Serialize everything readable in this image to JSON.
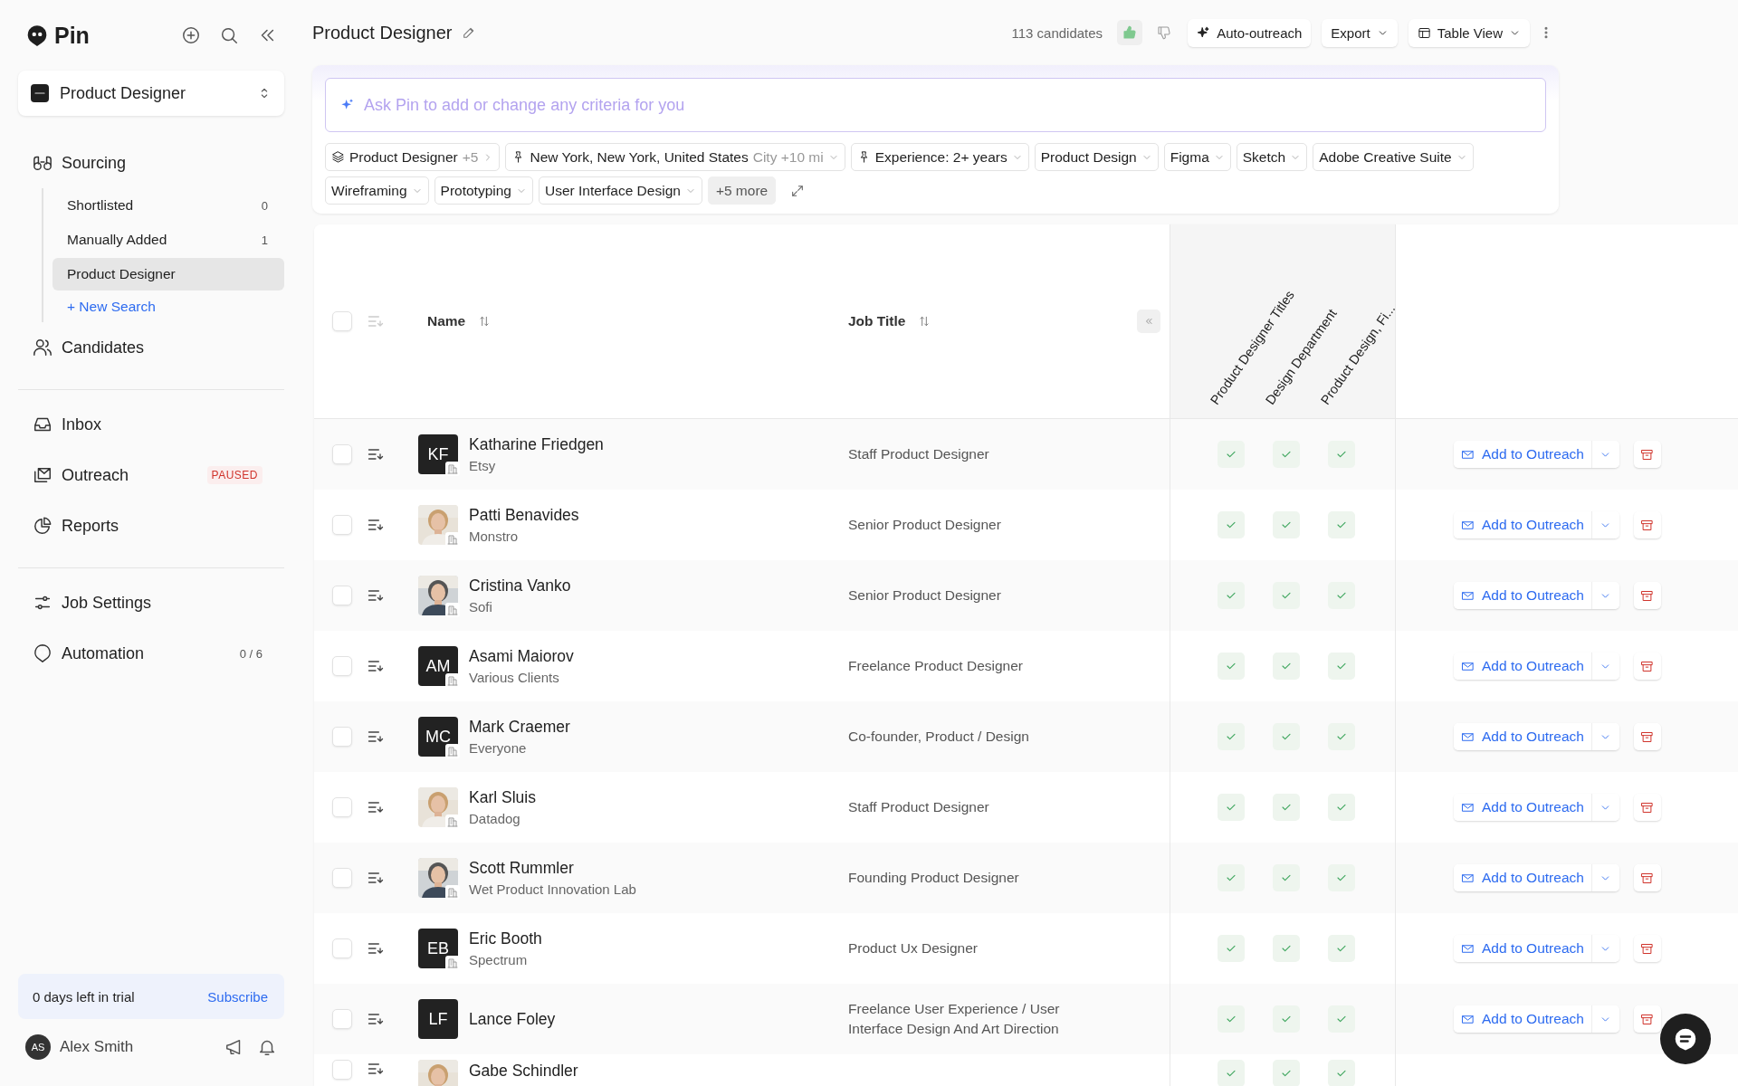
{
  "sidebar": {
    "logo": "Pin",
    "workspace": "Product Designer",
    "groups": [
      {
        "items": [
          {
            "label": "Sourcing",
            "children": [
              {
                "label": "Shortlisted",
                "count": "0",
                "selected": false
              },
              {
                "label": "Manually Added",
                "count": "1",
                "selected": false
              },
              {
                "label": "Product Designer",
                "selected": true
              }
            ],
            "new_search": "+ New Search"
          },
          {
            "label": "Candidates"
          }
        ]
      },
      {
        "items": [
          {
            "label": "Inbox"
          },
          {
            "label": "Outreach",
            "badge": "PAUSED"
          },
          {
            "label": "Reports"
          }
        ]
      },
      {
        "items": [
          {
            "label": "Job Settings"
          },
          {
            "label": "Automation",
            "count": "0 / 6"
          }
        ]
      }
    ],
    "trial": {
      "text": "0 days left in trial",
      "link": "Subscribe"
    },
    "user": {
      "initials": "AS",
      "name": "Alex Smith"
    }
  },
  "header": {
    "title": "Product Designer",
    "count": "113 candidates",
    "buttons": [
      {
        "label": "Auto-outreach",
        "kind": "sparkle"
      },
      {
        "label": "Export",
        "kind": "menu"
      },
      {
        "label": "Table View",
        "kind": "view"
      }
    ]
  },
  "criteria": {
    "placeholder": "Ask Pin to add or change any criteria for you",
    "chips": [
      {
        "kind": "title",
        "label": "Product Designer",
        "suffix": "+5"
      },
      {
        "kind": "location",
        "label": "New York, New York, United States",
        "suffix": "City +10 mi"
      },
      {
        "kind": "pinned",
        "label": "Experience: 2+ years"
      },
      {
        "kind": "plain",
        "label": "Product Design"
      },
      {
        "kind": "plain",
        "label": "Figma"
      },
      {
        "kind": "plain",
        "label": "Sketch"
      },
      {
        "kind": "plain",
        "label": "Adobe Creative Suite"
      },
      {
        "kind": "plain",
        "label": "Wireframing"
      },
      {
        "kind": "plain",
        "label": "Prototyping"
      },
      {
        "kind": "plain",
        "label": "User Interface Design"
      },
      {
        "kind": "more",
        "label": "+5 more"
      }
    ]
  },
  "table": {
    "select_all": {
      "checked": false
    },
    "columns": [
      "Name",
      "Job Title"
    ],
    "criteria_columns": [
      "Product Designer Titles",
      "Design Department",
      "Product Design, Fi..."
    ],
    "rows": [
      {
        "checked": false,
        "avatar": {
          "kind": "initials",
          "text": "KF"
        },
        "name": "Katharine Friedgen",
        "company": "Etsy",
        "title": "Staff Product Designer",
        "checks": [
          {
            "met": true
          },
          {
            "met": true
          },
          {
            "met": true
          }
        ],
        "action": "Add to Outreach"
      },
      {
        "checked": false,
        "name": "Patti Benavides",
        "company": "Monstro",
        "title": "Senior Product Designer",
        "checks": [
          {
            "met": true
          },
          {
            "met": true
          },
          {
            "met": true
          }
        ],
        "action": "Add to Outreach"
      },
      {
        "checked": false,
        "name": "Cristina Vanko",
        "company": "Sofi",
        "title": "Senior Product Designer",
        "checks": [
          {
            "met": true
          },
          {
            "met": true
          },
          {
            "met": true
          }
        ],
        "action": "Add to Outreach"
      },
      {
        "checked": false,
        "avatar": {
          "kind": "initials",
          "text": "AM"
        },
        "name": "Asami Maiorov",
        "company": "Various Clients",
        "title": "Freelance Product Designer",
        "checks": [
          {
            "met": true
          },
          {
            "met": true
          },
          {
            "met": true
          }
        ],
        "action": "Add to Outreach"
      },
      {
        "checked": false,
        "avatar": {
          "kind": "initials",
          "text": "MC"
        },
        "name": "Mark Craemer",
        "company": "Everyone",
        "title": "Co-founder, Product / Design",
        "checks": [
          {
            "met": true
          },
          {
            "met": true
          },
          {
            "met": true
          }
        ],
        "action": "Add to Outreach"
      },
      {
        "checked": false,
        "name": "Karl Sluis",
        "company": "Datadog",
        "title": "Staff Product Designer",
        "checks": [
          {
            "met": true
          },
          {
            "met": true
          },
          {
            "met": true
          }
        ],
        "action": "Add to Outreach"
      },
      {
        "checked": false,
        "name": "Scott Rummler",
        "company": "Wet Product Innovation Lab",
        "title": "Founding Product Designer",
        "checks": [
          {
            "met": true
          },
          {
            "met": true
          },
          {
            "met": true
          }
        ],
        "action": "Add to Outreach"
      },
      {
        "checked": false,
        "avatar": {
          "kind": "initials",
          "text": "EB"
        },
        "name": "Eric Booth",
        "company": "Spectrum",
        "title": "Product Ux Designer",
        "checks": [
          {
            "met": true
          },
          {
            "met": true
          },
          {
            "met": true
          }
        ],
        "action": "Add to Outreach"
      },
      {
        "checked": false,
        "avatar": {
          "kind": "initials",
          "text": "LF"
        },
        "name": "Lance Foley",
        "title": "Freelance User Experience / User Interface Design And Art Direction",
        "checks": [
          {
            "met": true
          },
          {
            "met": true
          },
          {
            "met": true
          }
        ],
        "action": "Add to Outreach"
      },
      {
        "checked": false,
        "name": "Gabe Schindler",
        "checks": [
          {
            "met": true
          },
          {
            "met": true
          },
          {
            "met": true
          }
        ]
      }
    ]
  }
}
